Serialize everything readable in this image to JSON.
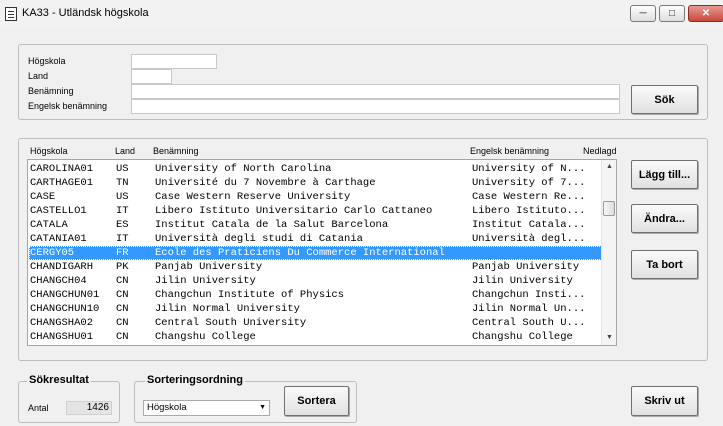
{
  "window": {
    "title": "KA33 - Utländsk högskola"
  },
  "search": {
    "labels": {
      "hogskola": "Högskola",
      "land": "Land",
      "benamning": "Benämning",
      "engelsk": "Engelsk benämning"
    },
    "values": {
      "hogskola": "",
      "land": "",
      "benamning": "",
      "engelsk": ""
    },
    "search_button": "Sök"
  },
  "list": {
    "columns": [
      "Högskola",
      "Land",
      "Benämning",
      "Engelsk benämning",
      "Nedlagd"
    ],
    "rows": [
      [
        "CAROLINA01",
        "US",
        "University of North Carolina",
        "University of N..."
      ],
      [
        "CARTHAGE01",
        "TN",
        "Université du 7 Novembre à Carthage",
        "University of 7..."
      ],
      [
        "CASE",
        "US",
        "Case Western Reserve University",
        "Case Western Re..."
      ],
      [
        "CASTELLO1",
        "IT",
        "Libero Istituto Universitario Carlo Cattaneo",
        "Libero Istituto..."
      ],
      [
        "CATALA",
        "ES",
        "Institut Catala de la Salut Barcelona",
        "Institut Catala..."
      ],
      [
        "CATANIA01",
        "IT",
        "Università degli studi di Catania",
        "Università degl..."
      ],
      [
        "CERGY05",
        "FR",
        "Ecole des Praticiens Du Commerce International",
        ""
      ],
      [
        "CHANDIGARH",
        "PK",
        "Panjab University",
        "Panjab University"
      ],
      [
        "CHANGCH04",
        "CN",
        "Jilin University",
        "Jilin University"
      ],
      [
        "CHANGCHUN01",
        "CN",
        "Changchun Institute of Physics",
        "Changchun Insti..."
      ],
      [
        "CHANGCHUN10",
        "CN",
        "Jilin Normal University",
        "Jilin Normal Un..."
      ],
      [
        "CHANGSHA02",
        "CN",
        "Central South University",
        "Central South U..."
      ],
      [
        "CHANGSHU01",
        "CN",
        "Changshu College",
        "Changshu College"
      ]
    ],
    "selected_index": 6
  },
  "actions": {
    "add": "Lägg till...",
    "edit": "Ändra...",
    "delete": "Ta bort",
    "print": "Skriv ut"
  },
  "result": {
    "title": "Sökresultat",
    "count_label": "Antal",
    "count": "1426"
  },
  "sort": {
    "title": "Sorteringsordning",
    "selected": "Högskola",
    "button": "Sortera"
  },
  "colors": {
    "selection": "#3399ff"
  }
}
